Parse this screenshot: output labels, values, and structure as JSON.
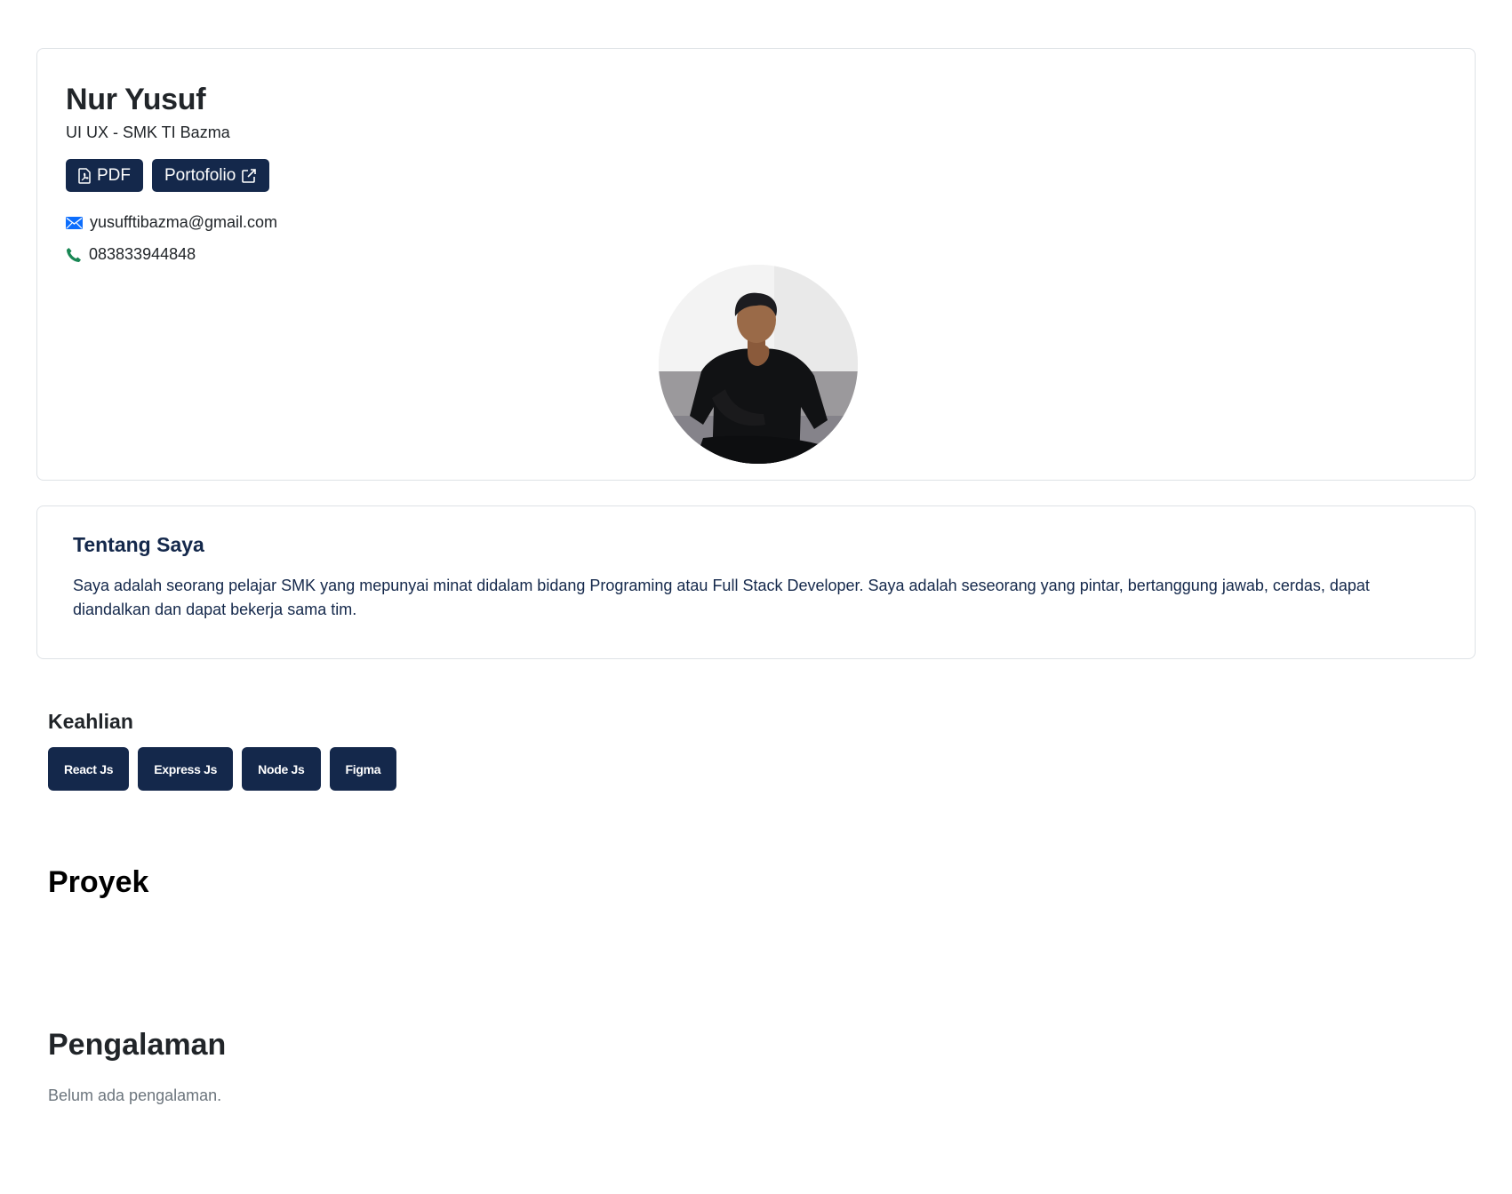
{
  "profile": {
    "name": "Nur Yusuf",
    "role": "UI UX - SMK TI Bazma",
    "pdf_label": "PDF",
    "portfolio_label": "Portofolio",
    "email": "yusufftibazma@gmail.com",
    "phone": "083833944848"
  },
  "about": {
    "title": "Tentang Saya",
    "text": "Saya adalah seorang pelajar SMK yang mepunyai minat didalam bidang Programing atau Full Stack Developer. Saya adalah seseorang yang pintar, bertanggung jawab, cerdas, dapat diandalkan dan dapat bekerja sama tim."
  },
  "skills": {
    "title": "Keahlian",
    "items": [
      "React Js",
      "Express Js",
      "Node Js",
      "Figma"
    ]
  },
  "projects": {
    "title": "Proyek"
  },
  "experience": {
    "title": "Pengalaman",
    "empty_text": "Belum ada pengalaman."
  },
  "colors": {
    "primary": "#14284b",
    "email_icon": "#0d6efd",
    "phone_icon": "#198754"
  },
  "icons": {
    "pdf": "file-pdf-icon",
    "portfolio": "external-link-icon",
    "email": "envelope-icon",
    "phone": "telephone-icon"
  }
}
